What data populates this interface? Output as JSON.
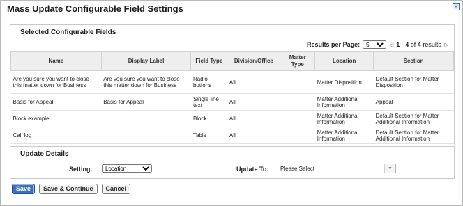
{
  "dialog": {
    "title": "Mass Update Configurable Field Settings",
    "close_icon": "close-icon"
  },
  "fields_panel": {
    "title": "Selected Configurable Fields",
    "pager": {
      "label": "Results per Page:",
      "per_page": "5",
      "range": "1 - 4",
      "of_text": "of",
      "total": "4",
      "suffix": "results",
      "prev_icon": "prev-page-icon",
      "next_icon": "next-page-icon"
    },
    "columns": [
      "Name",
      "Display Label",
      "Field Type",
      "Division/Office",
      "Matter Type",
      "Location",
      "Section"
    ],
    "rows": [
      {
        "name": "Are you sure you want to close this matter down for Business",
        "display_label": "Are you sure you want to close this matter down for Business",
        "field_type": "Radio buttons",
        "division": "All",
        "matter_type": "",
        "location": "Matter Disposition",
        "section": "Default Section for Matter Disposition"
      },
      {
        "name": "Basis for Appeal",
        "display_label": "Basis for Appeal",
        "field_type": "Single line text",
        "division": "All",
        "matter_type": "",
        "location": "Matter Additional Information",
        "section": "Appeal"
      },
      {
        "name": "Block example",
        "display_label": "",
        "field_type": "Block",
        "division": "All",
        "matter_type": "",
        "location": "Matter Additional Information",
        "section": "Default Section for Matter Additional Information"
      },
      {
        "name": "Call log",
        "display_label": "",
        "field_type": "Table",
        "division": "All",
        "matter_type": "",
        "location": "Matter Additional Information",
        "section": "Default Section for Matter Additional Information"
      }
    ]
  },
  "update_panel": {
    "title": "Update Details",
    "setting_label": "Setting:",
    "setting_value": "Location",
    "update_to_label": "Update To:",
    "update_to_value": "Please Select"
  },
  "actions": {
    "save": "Save",
    "save_continue": "Save & Continue",
    "cancel": "Cancel"
  }
}
